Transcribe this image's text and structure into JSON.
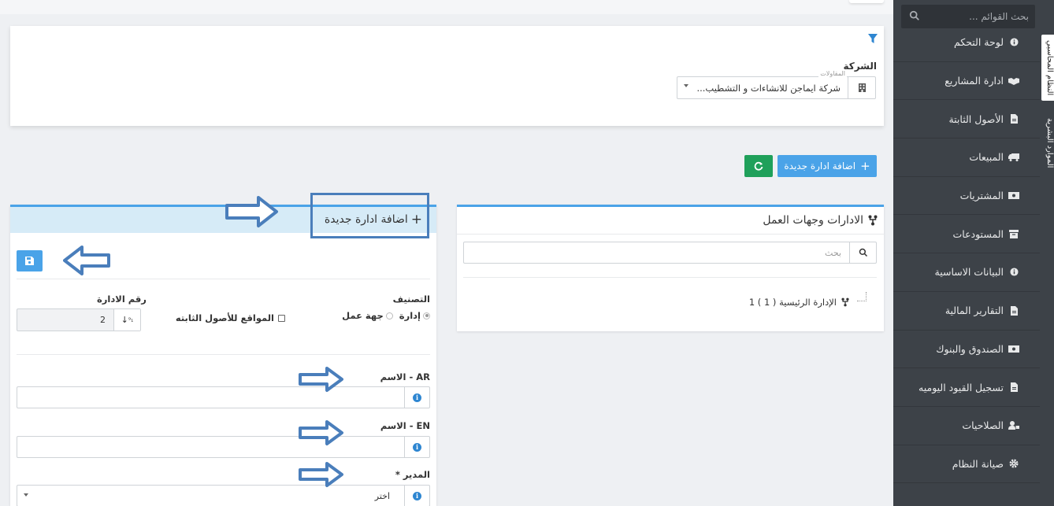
{
  "sidebar": {
    "search_placeholder": "بحث القوائم ...",
    "items": [
      {
        "label": "لوحة التحكم",
        "icon": "info-circle-icon"
      },
      {
        "label": "ادارة المشاريع",
        "icon": "handshake-icon"
      },
      {
        "label": "الأصول الثابتة",
        "icon": "document-icon"
      },
      {
        "label": "المبيعات",
        "icon": "truck-icon"
      },
      {
        "label": "المشتريات",
        "icon": "money-icon"
      },
      {
        "label": "المستودعات",
        "icon": "archive-icon"
      },
      {
        "label": "البيانات الاساسية",
        "icon": "info-circle-icon"
      },
      {
        "label": "التقارير المالية",
        "icon": "document-icon"
      },
      {
        "label": "الصندوق والبنوك",
        "icon": "money-icon"
      },
      {
        "label": "تسجيل القيود اليوميه",
        "icon": "document-icon"
      },
      {
        "label": "الصلاحيات",
        "icon": "user-lock-icon"
      },
      {
        "label": "صيانة النظام",
        "icon": "gear-icon"
      }
    ],
    "tabs": [
      "النظام المحاسبي",
      "الموارد البشرية"
    ]
  },
  "filter": {
    "company_label": "الشركة",
    "company_legend": "المقاولات",
    "company_value": "شركة ايماجن للانشاءات و التشطيب..."
  },
  "actions": {
    "add_label": "اضافة ادارة جديدة"
  },
  "tree": {
    "title": "الادارات وجهات العمل",
    "search_placeholder": "بحث",
    "node_label": "الإدارة الرئيسية ( 1 ) 1"
  },
  "form": {
    "title": "اضافة ادارة جديدة",
    "classification_label": "التصنيف",
    "option_department": "إدارة",
    "option_workplace": "جهة عمل",
    "fixed_assets_sites": "المواقع للأصول الثابته",
    "number_label": "رقم الادارة",
    "number_value": "2",
    "name_ar_label": "الاسم - AR",
    "name_en_label": "الاسم - EN",
    "manager_label": "المدير *",
    "manager_value": "اختر"
  },
  "colors": {
    "primary": "#4aa3e8",
    "success": "#1fa05a",
    "sidebar": "#3d4248",
    "annotation": "#4a7ebb"
  }
}
